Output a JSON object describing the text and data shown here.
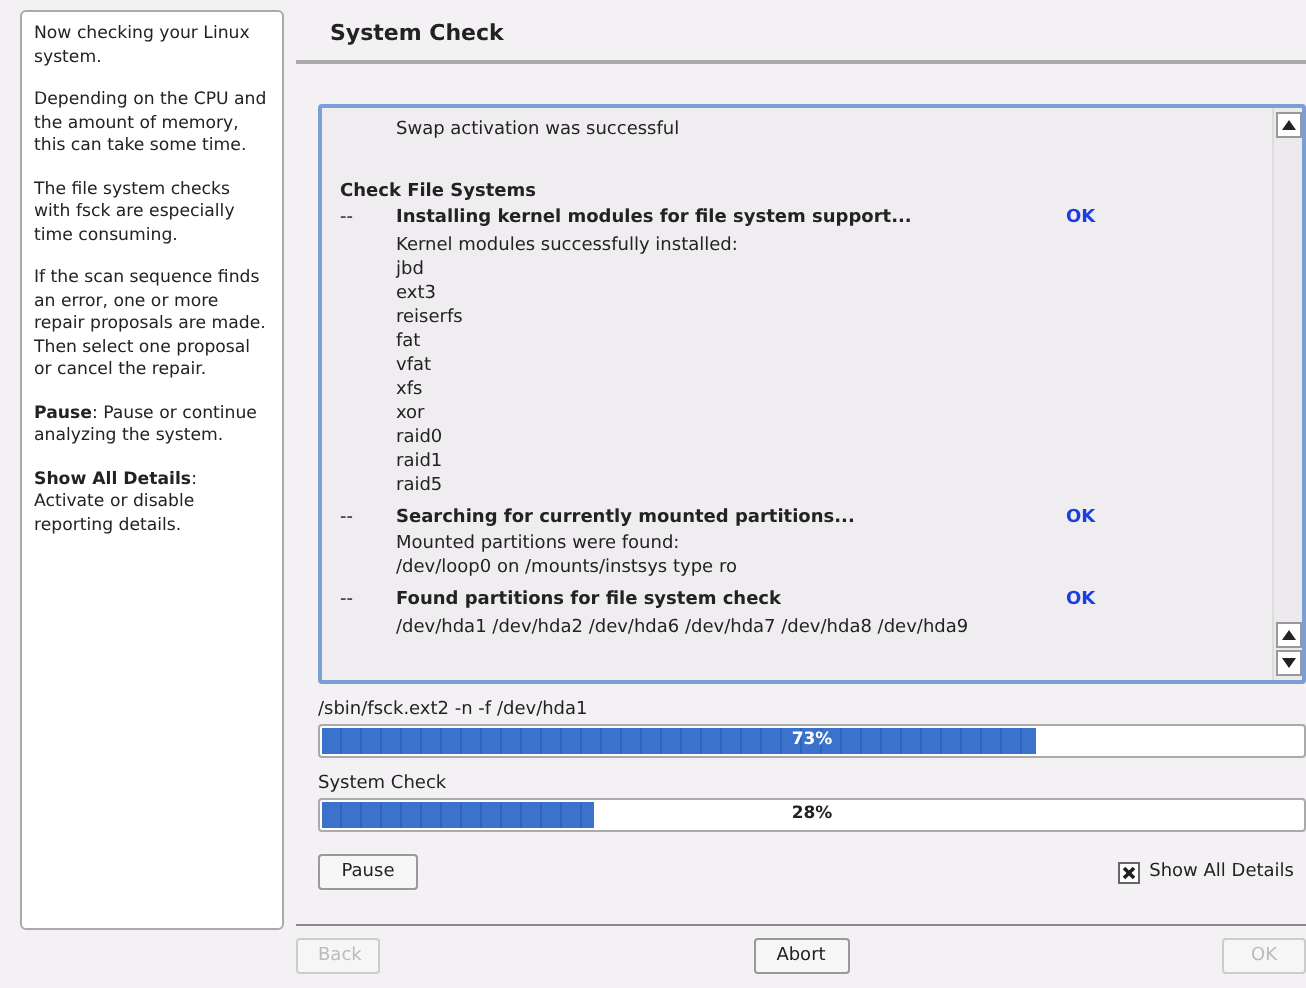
{
  "help": {
    "paragraphs": [
      "Now checking your Linux system.",
      "Depending on the CPU and the amount of memory, this can take some time.",
      "The file system checks with fsck are especially time consuming.",
      "If the scan sequence finds an error, one or more repair proposals are made. Then select one proposal or cancel the repair.",
      "**Pause**: Pause or continue analyzing the system.",
      "**Show All Details**: Activate or disable reporting details."
    ]
  },
  "title": "System Check",
  "log": [
    {
      "kind": "detail",
      "lines": [
        "Swap activation was successful"
      ]
    },
    {
      "kind": "gap"
    },
    {
      "kind": "section",
      "text": "Check File Systems"
    },
    {
      "kind": "step",
      "marker": "--",
      "text": "Installing kernel modules for file system support...",
      "status": "OK"
    },
    {
      "kind": "detail",
      "lines": [
        "Kernel modules successfully installed:",
        "jbd",
        "ext3",
        "reiserfs",
        "fat",
        "vfat",
        "xfs",
        "xor",
        "raid0",
        "raid1",
        "raid5"
      ]
    },
    {
      "kind": "step",
      "marker": "--",
      "text": "Searching for currently mounted partitions...",
      "status": "OK"
    },
    {
      "kind": "detail",
      "lines": [
        "Mounted partitions were found:",
        "/dev/loop0 on /mounts/instsys type ro"
      ]
    },
    {
      "kind": "step",
      "marker": "--",
      "text": "Found partitions for file system check",
      "status": "OK"
    },
    {
      "kind": "detail",
      "lines": [
        "/dev/hda1 /dev/hda2 /dev/hda6 /dev/hda7 /dev/hda8 /dev/hda9"
      ]
    }
  ],
  "progress": [
    {
      "label": "/sbin/fsck.ext2 -n -f /dev/hda1",
      "level": 0.73,
      "reading": "73%"
    },
    {
      "label": "System Check",
      "level": 0.28,
      "reading": "28%"
    }
  ],
  "pause_button": "Pause",
  "show_details": {
    "label": "Show All Details",
    "checked": true
  },
  "buttons": [
    {
      "label": "Back",
      "disabled": true
    },
    {
      "label": "Abort",
      "disabled": false
    },
    {
      "label": "OK",
      "disabled": true
    }
  ]
}
